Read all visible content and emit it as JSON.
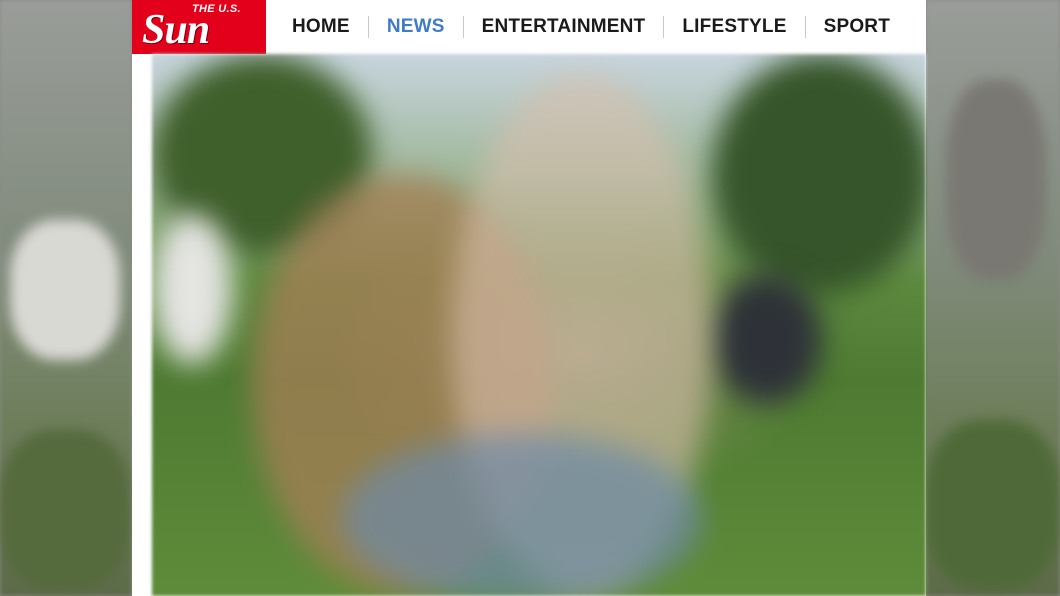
{
  "brand": {
    "logo_top": "THE U.S.",
    "logo_main": "Sun",
    "color": "#e2001a"
  },
  "nav": {
    "items": [
      {
        "label": "HOME",
        "active": false
      },
      {
        "label": "NEWS",
        "active": true
      },
      {
        "label": "ENTERTAINMENT",
        "active": false
      },
      {
        "label": "LIFESTYLE",
        "active": false
      },
      {
        "label": "SPORT",
        "active": false
      }
    ],
    "active_color": "#3d7cc9"
  }
}
